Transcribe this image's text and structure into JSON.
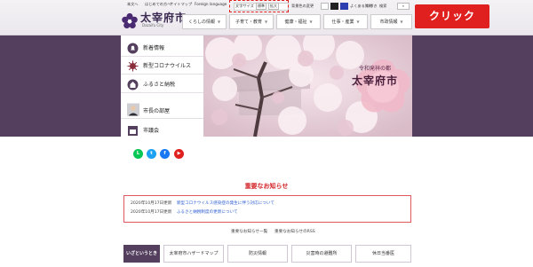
{
  "header": {
    "site_name": "太宰府市",
    "site_sub": "Dazaifu City",
    "util_links": [
      "本文へ",
      "はじめての方へ",
      "サイトマップ",
      "Foreign language"
    ],
    "text_size": {
      "label": "文字サイズ",
      "standard": "標準",
      "larger": "拡大"
    },
    "bg_color": {
      "label": "背景色の変更"
    },
    "right_links": [
      "よくある質問",
      "つづき",
      "検索",
      "お問合せ"
    ],
    "nav": [
      "くらしの情報",
      "子育て・教育",
      "健康・福祉",
      "仕事・産業",
      "市政情報"
    ]
  },
  "callout": "クリック",
  "left_menu": [
    {
      "label": "新着情報",
      "icon": "bell-icon"
    },
    {
      "label": "新型コロナウイルス",
      "icon": "virus-icon"
    },
    {
      "label": "ふるさと納税",
      "icon": "hometown-tax-icon"
    },
    {
      "label": "市長の部屋",
      "icon": "mayor-photo"
    },
    {
      "label": "市議会",
      "icon": "assembly-icon"
    }
  ],
  "hero": {
    "badge_small": "令和発祥の都",
    "badge_big": "太宰府市"
  },
  "social": [
    "LINE",
    "Twitter",
    "Facebook",
    "YouTube"
  ],
  "notice": {
    "title": "重要なお知らせ",
    "items": [
      {
        "date": "2020年10月17日更新",
        "text": "新型コロナウイルス感染症の発生に伴う対応について"
      },
      {
        "date": "2020年10月17日更新",
        "text": "ふるさと納税制度の更新について"
      }
    ],
    "more": "重要なお知らせ一覧",
    "rss": "重要なお知らせのRSS"
  },
  "quick": {
    "label": "いざというとき",
    "buttons": [
      "太宰府市ハザードマップ",
      "防災情報",
      "災害時の避難所",
      "休日当番医"
    ]
  },
  "colors": {
    "brand": "#54405e",
    "accent": "#e0201f"
  }
}
